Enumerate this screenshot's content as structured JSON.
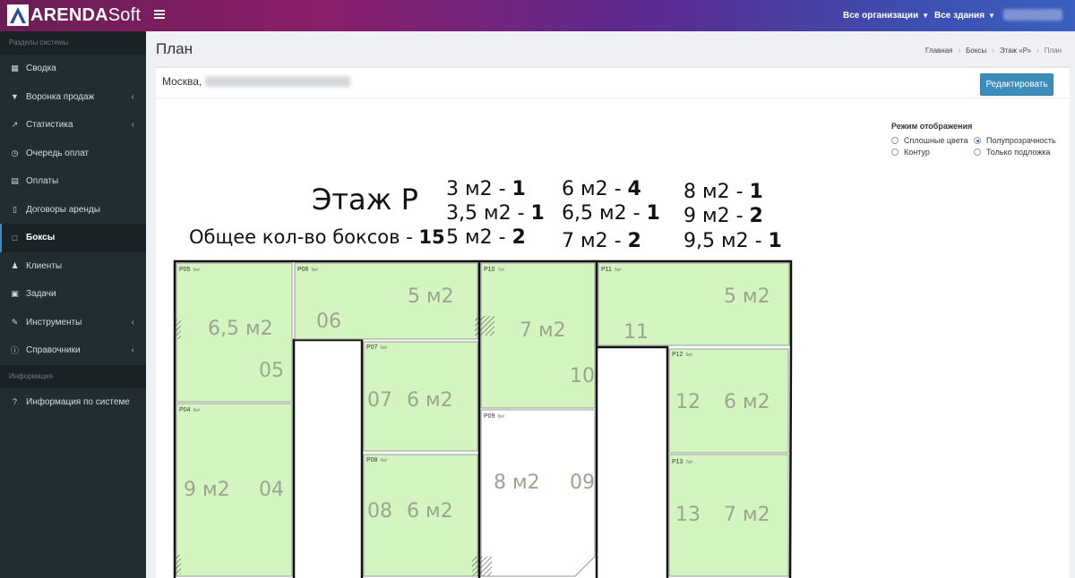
{
  "brand": {
    "name_bold": "ARENDA",
    "name_light": "Soft"
  },
  "navbar": {
    "orgs_label": "Все организации",
    "buildings_label": "Все здания"
  },
  "sidebar": {
    "section_system": "Разделы системы",
    "items": [
      {
        "label": "Сводка",
        "icon": "calendar-icon",
        "chevron": false
      },
      {
        "label": "Воронка продаж",
        "icon": "filter-icon",
        "chevron": true
      },
      {
        "label": "Статистика",
        "icon": "line-chart-icon",
        "chevron": true
      },
      {
        "label": "Очередь оплат",
        "icon": "clock-icon",
        "chevron": false
      },
      {
        "label": "Оплаты",
        "icon": "calculator-icon",
        "chevron": false
      },
      {
        "label": "Договоры аренды",
        "icon": "file-icon",
        "chevron": false
      },
      {
        "label": "Боксы",
        "icon": "square-icon",
        "chevron": false,
        "active": true
      },
      {
        "label": "Клиенты",
        "icon": "user-icon",
        "chevron": false
      },
      {
        "label": "Задачи",
        "icon": "calendar-check-icon",
        "chevron": false
      },
      {
        "label": "Инструменты",
        "icon": "wrench-icon",
        "chevron": true
      },
      {
        "label": "Справочники",
        "icon": "info-circle-icon",
        "chevron": true
      }
    ],
    "section_info": "Информация",
    "info_items": [
      {
        "label": "Информация по системе",
        "icon": "question-icon"
      }
    ]
  },
  "page": {
    "title": "План",
    "breadcrumb": [
      "Главная",
      "Боксы",
      "Этаж «Р»",
      "План"
    ],
    "address_prefix": "Москва,",
    "edit_button": "Редактировать"
  },
  "display_mode": {
    "title": "Режим отображения",
    "options": [
      {
        "label": "Сплошные цвета",
        "selected": false
      },
      {
        "label": "Полупрозрачность",
        "selected": true
      },
      {
        "label": "Контур",
        "selected": false
      },
      {
        "label": "Только подложка",
        "selected": false
      }
    ]
  },
  "plan": {
    "floor_title": "Этаж Р",
    "total_label": "Общее кол-во боксов - ",
    "total_value": "15",
    "legend": [
      {
        "size": "3 м2 - ",
        "count": "1"
      },
      {
        "size": "3,5 м2 - ",
        "count": "1"
      },
      {
        "size": "5 м2 - ",
        "count": "2"
      },
      {
        "size": "6 м2 - ",
        "count": "4"
      },
      {
        "size": "6,5 м2 - ",
        "count": "1"
      },
      {
        "size": "7 м2 - ",
        "count": "2"
      },
      {
        "size": "8 м2 - ",
        "count": "1"
      },
      {
        "size": "9 м2 - ",
        "count": "2"
      },
      {
        "size": "9,5 м2 - ",
        "count": "1"
      }
    ],
    "boxes": [
      {
        "code": "Р05",
        "area_tag": "6м²",
        "num": "05",
        "area": "6,5 м2",
        "fill": "#d4f5c0"
      },
      {
        "code": "Р06",
        "area_tag": "5м²",
        "num": "06",
        "area": "5 м2",
        "fill": "#d4f5c0"
      },
      {
        "code": "Р10",
        "area_tag": "7м²",
        "num": "10",
        "area": "7 м2",
        "fill": "#d4f5c0"
      },
      {
        "code": "Р11",
        "area_tag": "5м²",
        "num": "11",
        "area": "5 м2",
        "fill": "#d4f5c0"
      },
      {
        "code": "Р07",
        "area_tag": "6м²",
        "num": "07",
        "area": "6 м2",
        "fill": "#d4f5c0"
      },
      {
        "code": "Р12",
        "area_tag": "6м²",
        "num": "12",
        "area": "6 м2",
        "fill": "#d4f5c0"
      },
      {
        "code": "Р04",
        "area_tag": "9м²",
        "num": "04",
        "area": "9 м2",
        "fill": "#d4f5c0"
      },
      {
        "code": "Р09",
        "area_tag": "8м²",
        "num": "09",
        "area": "8 м2",
        "fill": "#ffffff"
      },
      {
        "code": "Р08",
        "area_tag": "6м²",
        "num": "08",
        "area": "6 м2",
        "fill": "#d4f5c0"
      },
      {
        "code": "Р13",
        "area_tag": "7м²",
        "num": "13",
        "area": "7 м2",
        "fill": "#d4f5c0"
      }
    ]
  }
}
